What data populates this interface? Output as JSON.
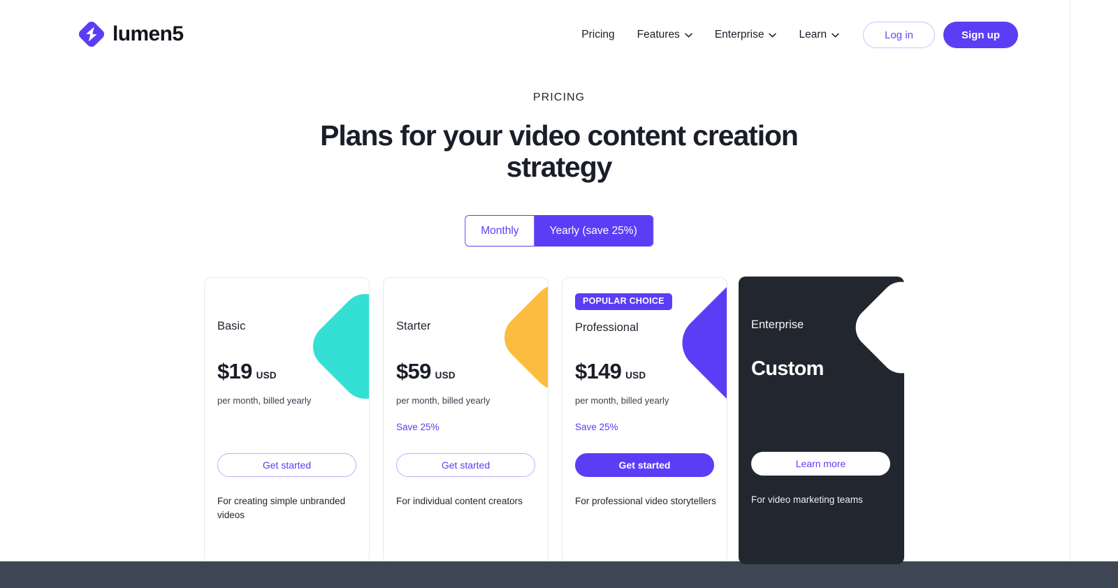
{
  "header": {
    "logo": {
      "icon": "lumen5-logo-icon",
      "text": "lumen5"
    },
    "nav": [
      {
        "label": "Pricing",
        "has_dropdown": false
      },
      {
        "label": "Features",
        "has_dropdown": true
      },
      {
        "label": "Enterprise",
        "has_dropdown": true
      },
      {
        "label": "Learn",
        "has_dropdown": true
      }
    ],
    "login_label": "Log in",
    "signup_label": "Sign up"
  },
  "hero": {
    "eyebrow": "PRICING",
    "headline": "Plans for your video content creation strategy"
  },
  "billing_toggle": {
    "options": [
      {
        "label": "Monthly",
        "active": false
      },
      {
        "label": "Yearly (save 25%)",
        "active": true
      }
    ],
    "selected": "Yearly (save 25%)"
  },
  "plans": [
    {
      "name": "Basic",
      "badge": null,
      "price": "$19",
      "currency": "USD",
      "period": "per month, billed yearly",
      "savings": null,
      "cta_label": "Get started",
      "blurb": "For creating simple unbranded videos",
      "accent_color": "#34e0d3",
      "theme": "light"
    },
    {
      "name": "Starter",
      "badge": null,
      "price": "$59",
      "currency": "USD",
      "period": "per month, billed yearly",
      "savings": "Save 25%",
      "cta_label": "Get started",
      "blurb": "For individual content creators",
      "accent_color": "#fbbc3f",
      "theme": "light"
    },
    {
      "name": "Professional",
      "badge": "POPULAR CHOICE",
      "price": "$149",
      "currency": "USD",
      "period": "per month, billed yearly",
      "savings": "Save 25%",
      "cta_label": "Get started",
      "blurb": "For professional video storytellers",
      "accent_color": "#5b3df5",
      "theme": "light"
    },
    {
      "name": "Enterprise",
      "badge": null,
      "price": "Custom",
      "currency": null,
      "period": null,
      "savings": null,
      "cta_label": "Learn more",
      "blurb": "For video marketing teams",
      "accent_color": "#ffffff",
      "theme": "dark"
    }
  ],
  "colors": {
    "brand_purple": "#5b3df5",
    "dark_card": "#22262f",
    "bottom_bar": "#3e4553",
    "text_dark": "#1b1e29",
    "teal": "#34e0d3",
    "orange": "#fbbc3f"
  }
}
